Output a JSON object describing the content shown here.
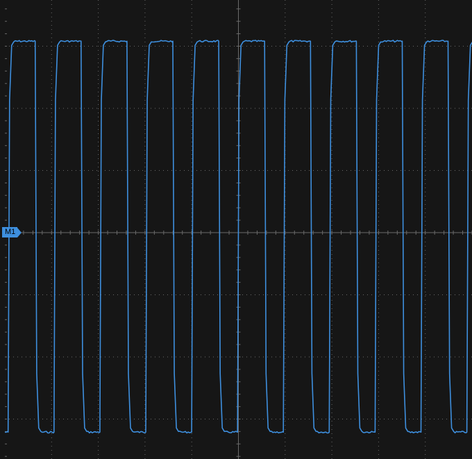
{
  "marker": {
    "label": "M1",
    "color": "#3e8fde"
  },
  "colors": {
    "background": "#161616",
    "grid": "#6a6a6a",
    "trace": "#3e8fde"
  },
  "chart_data": {
    "type": "line",
    "title": "",
    "xlabel": "",
    "ylabel": "",
    "grid": true,
    "divisions": {
      "x": 10,
      "y": 8
    },
    "ylim": [
      -4,
      4
    ],
    "xlim": [
      0,
      10
    ],
    "series": [
      {
        "values_description_levels": {
          "high": 3.08,
          "low": -3.21,
          "marker_level": 0
        },
        "period_div": 0.982,
        "first_rise_div": 0.07,
        "high_duration_div": 0.58,
        "rise_time_div": 0.09,
        "fall_time_div": 0.09,
        "cycles": 11
      }
    ]
  }
}
